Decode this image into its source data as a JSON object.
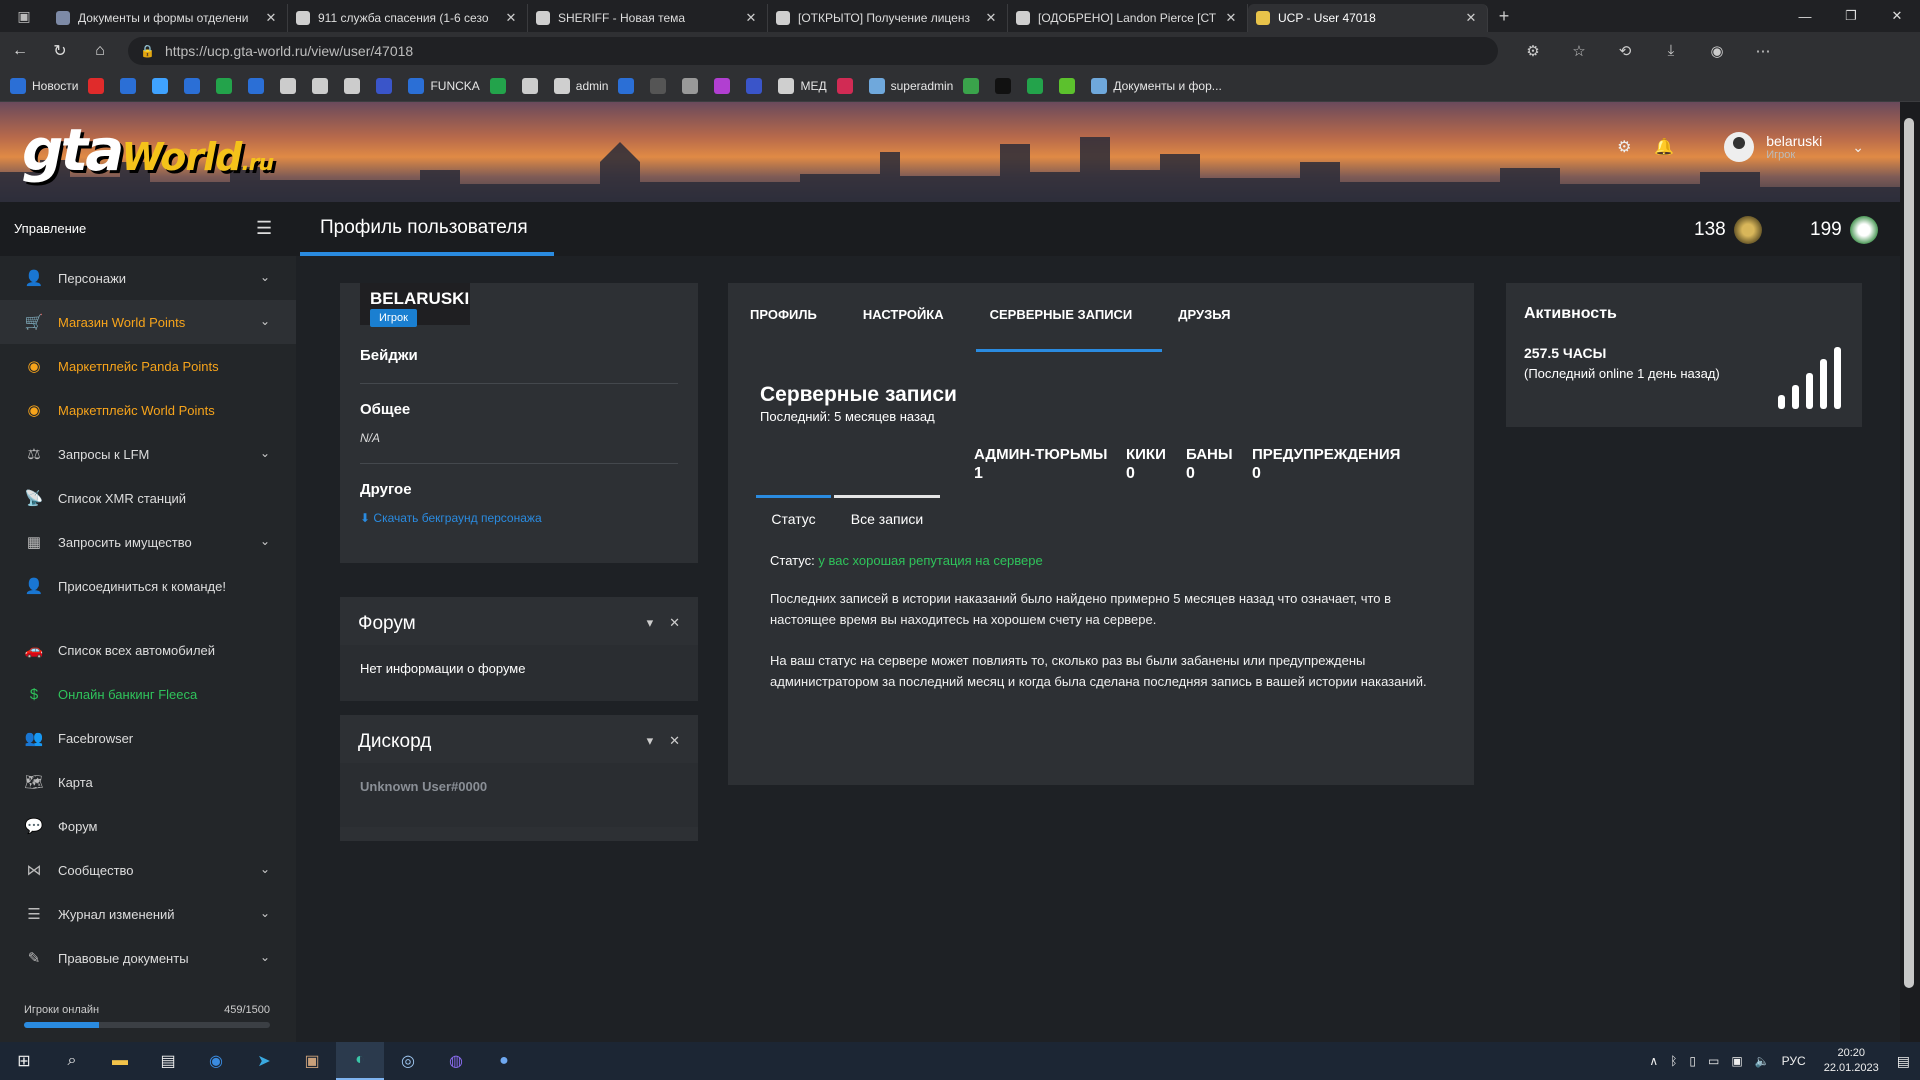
{
  "browser": {
    "tabs": [
      {
        "title": "Документы и формы отделени",
        "color": "#7d8aa6"
      },
      {
        "title": "911 служба спасения (1-6 сезо",
        "color": "#cfcfcf"
      },
      {
        "title": "SHERIFF - Новая тема",
        "color": "#cfcfcf"
      },
      {
        "title": "[ОТКРЫТО] Получение лиценз",
        "color": "#cfcfcf"
      },
      {
        "title": "[ОДОБРЕНО] Landon Pierce [СТ",
        "color": "#cfcfcf"
      },
      {
        "title": "UCP - User 47018",
        "color": "#e8c34a"
      }
    ],
    "url": "https://ucp.gta-world.ru/view/user/47018",
    "bookmarks": [
      {
        "label": "Новости",
        "color": "#2b6fd6"
      },
      {
        "label": "",
        "color": "#e02b2b"
      },
      {
        "label": "",
        "color": "#2b6fd6"
      },
      {
        "label": "",
        "color": "#3fa2ff"
      },
      {
        "label": "",
        "color": "#2b6fd6"
      },
      {
        "label": "",
        "color": "#23a34b"
      },
      {
        "label": "",
        "color": "#2b6fd6"
      },
      {
        "label": "",
        "color": "#cccccc"
      },
      {
        "label": "",
        "color": "#cccccc"
      },
      {
        "label": "",
        "color": "#cccccc"
      },
      {
        "label": "",
        "color": "#3a55c9"
      },
      {
        "label": "FUNCKA",
        "color": "#2b6fd6"
      },
      {
        "label": "",
        "color": "#23a34b"
      },
      {
        "label": "",
        "color": "#cccccc"
      },
      {
        "label": "admin",
        "color": "#cfcfcf"
      },
      {
        "label": "",
        "color": "#2b6fd6"
      },
      {
        "label": "",
        "color": "#555555"
      },
      {
        "label": "",
        "color": "#999999"
      },
      {
        "label": "",
        "color": "#b13fd1"
      },
      {
        "label": "",
        "color": "#3a55c9"
      },
      {
        "label": "МЕД",
        "color": "#cfcfcf"
      },
      {
        "label": "",
        "color": "#d12b54"
      },
      {
        "label": "superadmin",
        "color": "#6fa8dc"
      },
      {
        "label": "",
        "color": "#3aa34b"
      },
      {
        "label": "",
        "color": "#111111"
      },
      {
        "label": "",
        "color": "#23a34b"
      },
      {
        "label": "",
        "color": "#5cc12d"
      },
      {
        "label": "Документы и фор...",
        "color": "#6fa8dc"
      }
    ]
  },
  "header": {
    "logo_main": "gta",
    "logo_world": "World",
    "logo_domain": ".ru",
    "user_name": "belaruski",
    "user_role": "Игрок"
  },
  "topbar": {
    "management": "Управление",
    "page_title": "Профиль пользователя",
    "stat1": "138",
    "stat2": "199"
  },
  "sidebar": {
    "items": [
      {
        "label": "Персонажи",
        "icon": "person-icon",
        "glyph": "👤",
        "chev": true,
        "style": ""
      },
      {
        "label": "Магазин World Points",
        "icon": "cart-icon",
        "glyph": "🛒",
        "chev": true,
        "style": "orange active"
      },
      {
        "label": "Маркетплейс Panda Points",
        "icon": "coins-icon",
        "glyph": "◉",
        "chev": false,
        "style": "orange"
      },
      {
        "label": "Маркетплейс World Points",
        "icon": "coins-icon",
        "glyph": "◉",
        "chev": false,
        "style": "orange"
      },
      {
        "label": "Запросы к LFM",
        "icon": "scales-icon",
        "glyph": "⚖",
        "chev": true,
        "style": ""
      },
      {
        "label": "Список XMR станций",
        "icon": "antenna-icon",
        "glyph": "📡",
        "chev": false,
        "style": ""
      },
      {
        "label": "Запросить имущество",
        "icon": "building-icon",
        "glyph": "▦",
        "chev": true,
        "style": ""
      },
      {
        "label": "Присоединиться к команде!",
        "icon": "user-plus-icon",
        "glyph": "👤",
        "chev": false,
        "style": ""
      },
      {
        "label": "",
        "icon": "",
        "glyph": "",
        "chev": false,
        "style": "gap"
      },
      {
        "label": "Список всех автомобилей",
        "icon": "car-icon",
        "glyph": "🚗",
        "chev": false,
        "style": ""
      },
      {
        "label": "Онлайн банкинг Fleeca",
        "icon": "money-icon",
        "glyph": "$",
        "chev": false,
        "style": "green"
      },
      {
        "label": "Facebrowser",
        "icon": "users-icon",
        "glyph": "👥",
        "chev": false,
        "style": ""
      },
      {
        "label": "Карта",
        "icon": "map-icon",
        "glyph": "🗺",
        "chev": false,
        "style": ""
      },
      {
        "label": "Форум",
        "icon": "chat-icon",
        "glyph": "💬",
        "chev": false,
        "style": ""
      },
      {
        "label": "Сообщество",
        "icon": "share-icon",
        "glyph": "⋈",
        "chev": true,
        "style": ""
      },
      {
        "label": "Журнал изменений",
        "icon": "list-icon",
        "glyph": "☰",
        "chev": true,
        "style": ""
      },
      {
        "label": "Правовые документы",
        "icon": "document-icon",
        "glyph": "✎",
        "chev": true,
        "style": ""
      }
    ],
    "online_label": "Игроки онлайн",
    "online_count": "459/1500",
    "online_fraction": 0.306
  },
  "profile": {
    "username": "BELARUSKI",
    "role": "Игрок",
    "badges_label": "Бейджи",
    "general_label": "Общее",
    "general_value": "N/A",
    "other_label": "Другое",
    "download_link": "Скачать бекграунд персонажа"
  },
  "forum": {
    "title": "Форум",
    "body": "Нет информации о форуме"
  },
  "discord": {
    "title": "Дискорд",
    "body": "Unknown User#0000"
  },
  "main": {
    "tabs": [
      "ПРОФИЛЬ",
      "НАСТРОЙКА",
      "СЕРВЕРНЫЕ ЗАПИСИ",
      "ДРУЗЬЯ"
    ],
    "title": "Серверные записи",
    "subtitle": "Последний: 5 месяцев назад",
    "stats": [
      {
        "label": "АДМИН-ТЮРЬМЫ",
        "value": "1"
      },
      {
        "label": "КИКИ",
        "value": "0"
      },
      {
        "label": "БАНЫ",
        "value": "0"
      },
      {
        "label": "ПРЕДУПРЕЖДЕНИЯ",
        "value": "0"
      }
    ],
    "subtabs": [
      "Статус",
      "Все записи"
    ],
    "status_label": "Статус:",
    "status_value": "у вас хорошая репутация на сервере",
    "para1": "Последних записей в истории наказаний было найдено примерно 5 месяцев назад что означает, что в настоящее время вы находитесь на хорошем счету на сервере.",
    "para2": "На ваш статус на сервере может повлиять то, сколько раз вы были забанены или предупреждены администратором за последний месяц и когда была сделана последняя запись в вашей истории наказаний."
  },
  "activity": {
    "title": "Активность",
    "hours": "257.5 ЧАСЫ",
    "last_online": "(Последний online 1 день назад)"
  },
  "taskbar": {
    "lang": "РУС",
    "time": "20:20",
    "date": "22.01.2023"
  }
}
